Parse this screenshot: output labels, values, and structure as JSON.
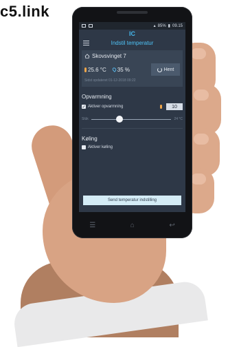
{
  "brand": "c5.link",
  "statusbar": {
    "battery": "85%",
    "time": "09.15"
  },
  "app": {
    "logo": "IC",
    "title": "Indstil temperatur"
  },
  "house": {
    "address": "Skovsvinget 7",
    "temperature": "25.6 °C",
    "humidity": "35 %",
    "fetch_label": "Hent",
    "updated": "Sidst opdateret 01-12-2018 09:22"
  },
  "heating": {
    "title": "Opvarmning",
    "checkbox_label": "Aktiver opvarmning",
    "checked": true,
    "setpoint": "10",
    "slider_min": "Slük",
    "slider_max": "24 °C",
    "slider_position": 0.35
  },
  "cooling": {
    "title": "Køling",
    "checkbox_label": "Aktiver køling",
    "checked": false
  },
  "send_label": "Send temperatur indstilling",
  "nav": {
    "menu": "☰",
    "home": "⌂",
    "back": "↩"
  },
  "colors": {
    "screen_bg": "#2e3847",
    "accent": "#4fc3f7",
    "send_bg": "#d4ecf6"
  }
}
